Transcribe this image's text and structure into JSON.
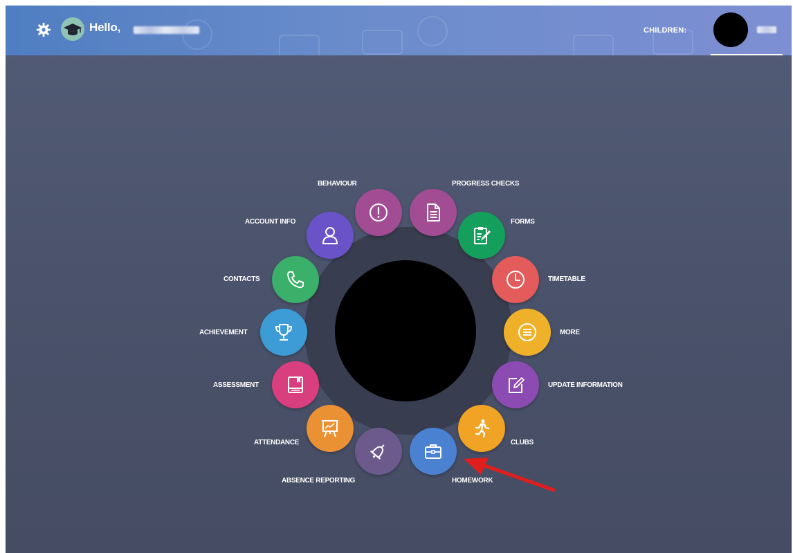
{
  "header": {
    "greeting": "Hello,",
    "children_label": "CHILDREN:"
  },
  "menu": {
    "behaviour": "BEHAVIOUR",
    "progress_checks": "PROGRESS CHECKS",
    "account_info": "ACCOUNT INFO",
    "forms": "FORMS",
    "contacts": "CONTACTS",
    "timetable": "TIMETABLE",
    "achievement": "ACHIEVEMENT",
    "more": "MORE",
    "assessment": "ASSESSMENT",
    "update_information": "UPDATE INFORMATION",
    "attendance": "ATTENDANCE",
    "clubs": "CLUBS",
    "absence_reporting": "ABSENCE REPORTING",
    "homework": "HOMEWORK"
  },
  "colors": {
    "behaviour": "#a24d93",
    "progress_checks": "#a24d93",
    "account_info": "#6a52c8",
    "forms": "#14a05c",
    "contacts": "#3bb06a",
    "timetable": "#e35b5b",
    "achievement": "#3d9bd6",
    "more": "#efb12a",
    "assessment": "#d93f7e",
    "update_information": "#8c4bb2",
    "attendance": "#ea9134",
    "clubs": "#f0a324",
    "absence_reporting": "#6c5a8c",
    "homework": "#4a81d1",
    "annotation_arrow": "#e01e1e"
  },
  "icons": {
    "settings": "gear-icon",
    "user_avatar": "graduation-cap-icon",
    "behaviour": "exclamation-icon",
    "progress_checks": "document-icon",
    "account_info": "person-icon",
    "forms": "form-edit-icon",
    "contacts": "phone-icon",
    "timetable": "clock-icon",
    "achievement": "trophy-icon",
    "more": "list-icon",
    "assessment": "book-icon",
    "update_information": "pencil-square-icon",
    "attendance": "presentation-board-icon",
    "clubs": "running-icon",
    "absence_reporting": "bell-icon",
    "homework": "briefcase-icon"
  }
}
